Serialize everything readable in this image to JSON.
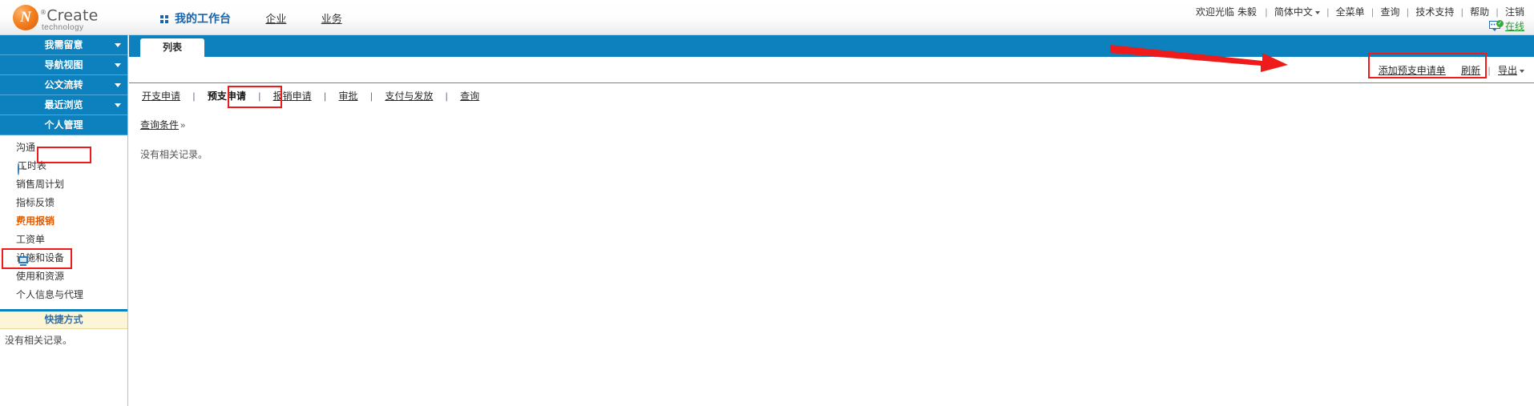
{
  "brand": {
    "name": "Create",
    "registered": "®",
    "tagline": "technology",
    "mark_glyph": "N"
  },
  "header": {
    "nav": [
      {
        "label": "我的工作台",
        "icon": "grid-icon",
        "active": true
      },
      {
        "label": "企业",
        "active": false
      },
      {
        "label": "业务",
        "active": false
      }
    ],
    "welcome": "欢迎光临",
    "user_name": "朱毅",
    "links": [
      {
        "label": "简体中文",
        "has_caret": true
      },
      {
        "label": "全菜单",
        "has_caret": false
      },
      {
        "label": "查询",
        "has_caret": false
      },
      {
        "label": "技术支持",
        "has_caret": false
      },
      {
        "label": "帮助",
        "has_caret": false
      },
      {
        "label": "注销",
        "has_caret": false
      }
    ],
    "separator": "|",
    "online_label": "在线",
    "online_icon": "chat-bubble-check-icon",
    "online_color": "#1f9e2d"
  },
  "sidebar": {
    "groups": [
      {
        "label": "我需留意",
        "highlighted": false
      },
      {
        "label": "导航视图",
        "highlighted": false
      },
      {
        "label": "公文流转",
        "highlighted": false
      },
      {
        "label": "最近浏览",
        "highlighted": false
      },
      {
        "label": "个人管理",
        "highlighted": true,
        "no_caret": true
      }
    ],
    "links": [
      {
        "label": "沟通",
        "icon": null,
        "accent": false
      },
      {
        "label": "工时表",
        "icon": "clock-icon",
        "accent": false
      },
      {
        "label": "销售周计划",
        "icon": null,
        "accent": false
      },
      {
        "label": "指标反馈",
        "icon": null,
        "accent": false
      },
      {
        "label": "费用报销",
        "icon": "globe-icon",
        "accent": true,
        "highlighted": true
      },
      {
        "label": "工资单",
        "icon": null,
        "accent": false
      },
      {
        "label": "设施和设备",
        "icon": "monitor-icon",
        "accent": false
      },
      {
        "label": "使用和资源",
        "icon": null,
        "accent": false
      },
      {
        "label": "个人信息与代理",
        "icon": null,
        "accent": false
      }
    ],
    "shortcut": {
      "title": "快捷方式",
      "empty_text": "没有相关记录。"
    },
    "collapse_handle": "sidebar-collapse-handle"
  },
  "main": {
    "tab": {
      "label": "列表",
      "active": true
    },
    "toolbar": {
      "add_label": "添加预支申请单",
      "refresh_label": "刷新",
      "export_label": "导出",
      "separator": "|"
    },
    "subtabs": [
      {
        "label": "开支申请",
        "active": false
      },
      {
        "label": "预支申请",
        "active": true,
        "highlighted": true
      },
      {
        "label": "报销申请",
        "active": false
      },
      {
        "label": "审批",
        "active": false
      },
      {
        "label": "支付与发放",
        "active": false
      },
      {
        "label": "查询",
        "active": false
      }
    ],
    "subtab_separator": "|",
    "query_conditions": {
      "label": "查询条件",
      "chevron": "»"
    },
    "empty_text": "没有相关记录。"
  },
  "annotations": {
    "highlight_color": "#ef1a1a",
    "arrow": "red-arrow-pointing-to-add-button",
    "boxes": [
      "个人管理",
      "费用报销",
      "预支申请",
      "添加预支申请单"
    ]
  },
  "colors": {
    "header_blue": "#0c81bd",
    "link_blue": "#1a63a8",
    "accent_orange": "#e05a00",
    "annotation_red": "#ef1a1a",
    "shortcut_yellow": "#fdf6d6"
  }
}
